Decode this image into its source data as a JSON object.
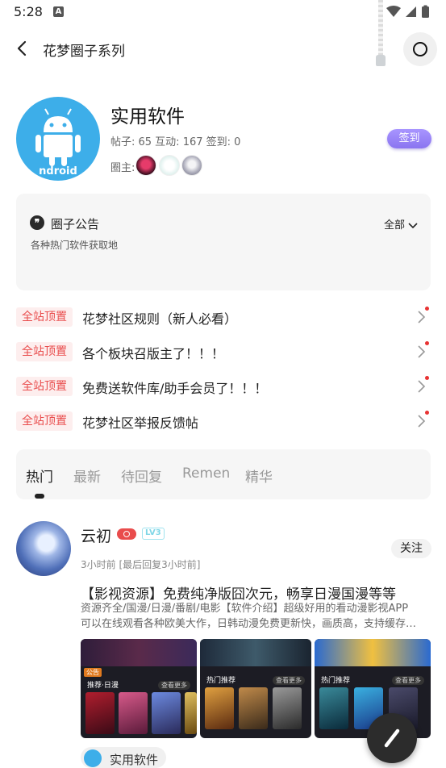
{
  "status_bar": {
    "time": "5:28",
    "notification_letter": "A"
  },
  "header": {
    "title": "花梦圈子系列"
  },
  "circle": {
    "name": "实用软件",
    "stats": "帖子: 65 互动: 167 签到: 0",
    "owner_label": "圈主:",
    "avatar_text": "ndroid",
    "signin_label": "签到"
  },
  "notice": {
    "title": "圈子公告",
    "filter": "全部",
    "text": "各种热门软件获取地"
  },
  "pinned": [
    {
      "tag": "全站顶置",
      "text": "花梦社区规则（新人必看）"
    },
    {
      "tag": "全站顶置",
      "text": "各个板块召版主了！！！"
    },
    {
      "tag": "全站顶置",
      "text": "免费送软件库/助手会员了！！！"
    },
    {
      "tag": "全站顶置",
      "text": "花梦社区举报反馈帖"
    }
  ],
  "tabs": [
    {
      "label": "热门",
      "active": true
    },
    {
      "label": "最新",
      "active": false
    },
    {
      "label": "待回复",
      "active": false
    },
    {
      "label": "Remen",
      "active": false
    },
    {
      "label": "精华",
      "active": false
    }
  ],
  "post": {
    "author": "云初",
    "level": "LV3",
    "time": "3小时前 [最后回复3小时前]",
    "follow_label": "关注",
    "title": "【影视资源】免费纯净版囧次元，畅享日漫国漫等等",
    "body_line1": "资源齐全/国漫/日漫/番剧/电影【软件介绍】超级好用的看动漫影视APP",
    "body_line2": "可以在线观看各种欧美大作，日韩动漫免费更新快，画质高，支持缓存…",
    "screenshots": [
      {
        "category": "推荐·日漫",
        "more": "查看更多",
        "notice_tag": "公告"
      },
      {
        "category": "热门推荐",
        "more": "查看更多"
      },
      {
        "category": "热门推荐",
        "more": "查看更多"
      }
    ],
    "circle_chip": "实用软件"
  },
  "colors": {
    "accent": "#8a74f0",
    "pin_red": "#e94c4c",
    "android_blue": "#3daee9"
  }
}
